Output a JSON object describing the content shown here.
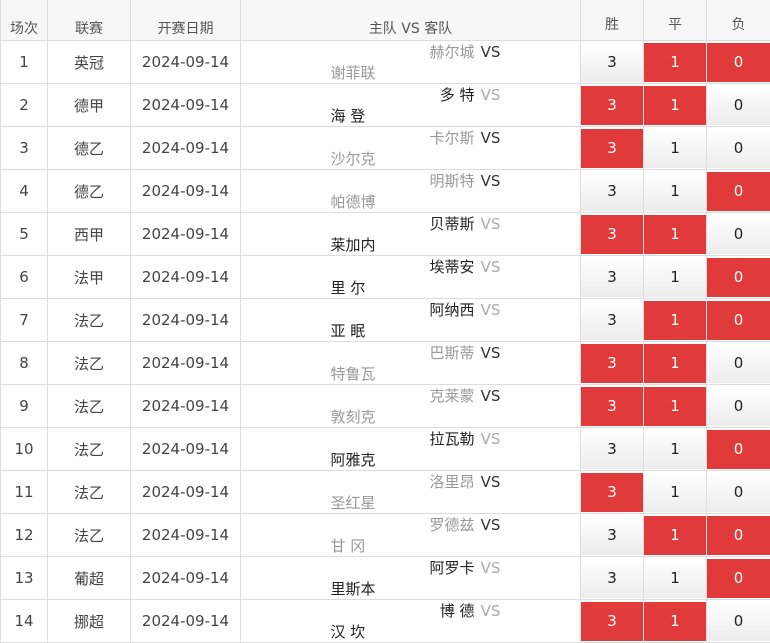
{
  "header": {
    "col_num": "场次",
    "col_league": "联赛",
    "col_date": "开赛日期",
    "col_home": "主队",
    "col_vs": "VS",
    "col_away": "客队",
    "col_win": "胜",
    "col_draw": "平",
    "col_lose": "负"
  },
  "colors": {
    "hit": "#e03a3a",
    "border": "#dddddd",
    "header_bg": "#f7f7f7"
  },
  "rows": [
    {
      "num": "1",
      "league": "英冠",
      "date": "2024-09-14",
      "home": "赫尔城",
      "away": "谢菲联",
      "home_dark": false,
      "away_dark": false,
      "vs_dark": true,
      "win": "3",
      "draw": "1",
      "lose": "0",
      "win_hit": false,
      "draw_hit": true,
      "lose_hit": true
    },
    {
      "num": "2",
      "league": "德甲",
      "date": "2024-09-14",
      "home": "多 特",
      "away": "海 登",
      "home_dark": true,
      "away_dark": true,
      "vs_dark": false,
      "win": "3",
      "draw": "1",
      "lose": "0",
      "win_hit": true,
      "draw_hit": true,
      "lose_hit": false
    },
    {
      "num": "3",
      "league": "德乙",
      "date": "2024-09-14",
      "home": "卡尔斯",
      "away": "沙尔克",
      "home_dark": false,
      "away_dark": false,
      "vs_dark": true,
      "win": "3",
      "draw": "1",
      "lose": "0",
      "win_hit": true,
      "draw_hit": false,
      "lose_hit": false
    },
    {
      "num": "4",
      "league": "德乙",
      "date": "2024-09-14",
      "home": "明斯特",
      "away": "帕德博",
      "home_dark": false,
      "away_dark": false,
      "vs_dark": true,
      "win": "3",
      "draw": "1",
      "lose": "0",
      "win_hit": false,
      "draw_hit": false,
      "lose_hit": true
    },
    {
      "num": "5",
      "league": "西甲",
      "date": "2024-09-14",
      "home": "贝蒂斯",
      "away": "莱加内",
      "home_dark": true,
      "away_dark": true,
      "vs_dark": false,
      "win": "3",
      "draw": "1",
      "lose": "0",
      "win_hit": true,
      "draw_hit": true,
      "lose_hit": false
    },
    {
      "num": "6",
      "league": "法甲",
      "date": "2024-09-14",
      "home": "埃蒂安",
      "away": "里 尔",
      "home_dark": true,
      "away_dark": true,
      "vs_dark": false,
      "win": "3",
      "draw": "1",
      "lose": "0",
      "win_hit": false,
      "draw_hit": false,
      "lose_hit": true
    },
    {
      "num": "7",
      "league": "法乙",
      "date": "2024-09-14",
      "home": "阿纳西",
      "away": "亚 眠",
      "home_dark": true,
      "away_dark": true,
      "vs_dark": false,
      "win": "3",
      "draw": "1",
      "lose": "0",
      "win_hit": false,
      "draw_hit": true,
      "lose_hit": true
    },
    {
      "num": "8",
      "league": "法乙",
      "date": "2024-09-14",
      "home": "巴斯蒂",
      "away": "特鲁瓦",
      "home_dark": false,
      "away_dark": false,
      "vs_dark": true,
      "win": "3",
      "draw": "1",
      "lose": "0",
      "win_hit": true,
      "draw_hit": true,
      "lose_hit": false
    },
    {
      "num": "9",
      "league": "法乙",
      "date": "2024-09-14",
      "home": "克莱蒙",
      "away": "敦刻克",
      "home_dark": false,
      "away_dark": false,
      "vs_dark": true,
      "win": "3",
      "draw": "1",
      "lose": "0",
      "win_hit": true,
      "draw_hit": true,
      "lose_hit": false
    },
    {
      "num": "10",
      "league": "法乙",
      "date": "2024-09-14",
      "home": "拉瓦勒",
      "away": "阿雅克",
      "home_dark": true,
      "away_dark": true,
      "vs_dark": false,
      "win": "3",
      "draw": "1",
      "lose": "0",
      "win_hit": false,
      "draw_hit": false,
      "lose_hit": true
    },
    {
      "num": "11",
      "league": "法乙",
      "date": "2024-09-14",
      "home": "洛里昂",
      "away": "圣红星",
      "home_dark": false,
      "away_dark": false,
      "vs_dark": true,
      "win": "3",
      "draw": "1",
      "lose": "0",
      "win_hit": true,
      "draw_hit": false,
      "lose_hit": false
    },
    {
      "num": "12",
      "league": "法乙",
      "date": "2024-09-14",
      "home": "罗德兹",
      "away": "甘 冈",
      "home_dark": false,
      "away_dark": false,
      "vs_dark": true,
      "win": "3",
      "draw": "1",
      "lose": "0",
      "win_hit": false,
      "draw_hit": true,
      "lose_hit": true
    },
    {
      "num": "13",
      "league": "葡超",
      "date": "2024-09-14",
      "home": "阿罗卡",
      "away": "里斯本",
      "home_dark": true,
      "away_dark": true,
      "vs_dark": false,
      "win": "3",
      "draw": "1",
      "lose": "0",
      "win_hit": false,
      "draw_hit": false,
      "lose_hit": true
    },
    {
      "num": "14",
      "league": "挪超",
      "date": "2024-09-14",
      "home": "博 德",
      "away": "汉 坎",
      "home_dark": true,
      "away_dark": true,
      "vs_dark": false,
      "win": "3",
      "draw": "1",
      "lose": "0",
      "win_hit": true,
      "draw_hit": true,
      "lose_hit": false
    }
  ]
}
